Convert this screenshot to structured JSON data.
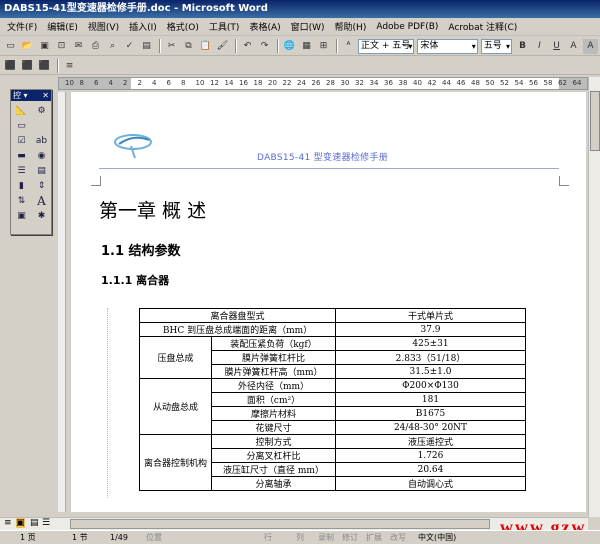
{
  "window": {
    "title": "DABS15-41型变速器检修手册.doc - Microsoft Word"
  },
  "menu": [
    "文件(F)",
    "编辑(E)",
    "视图(V)",
    "插入(I)",
    "格式(O)",
    "工具(T)",
    "表格(A)",
    "窗口(W)",
    "帮助(H)",
    "Adobe PDF(B)",
    "Acrobat 注释(C)"
  ],
  "toolbar": {
    "style_value": "正文 + 五号",
    "font_value": "宋体",
    "size_value": "五号",
    "bold": "B",
    "italic": "I",
    "underline": "U",
    "font_color": "A",
    "char_shading": "A"
  },
  "floatbar": {
    "title": "控"
  },
  "ruler": {
    "labels": [
      "10",
      "8",
      "6",
      "4",
      "2",
      "2",
      "4",
      "6",
      "8",
      "10",
      "12",
      "14",
      "16",
      "18",
      "20",
      "22",
      "24",
      "26",
      "28",
      "30",
      "32",
      "34",
      "36",
      "38",
      "40",
      "42",
      "44",
      "46",
      "48",
      "50",
      "52",
      "54",
      "56",
      "58",
      "62",
      "64"
    ]
  },
  "document": {
    "header": "DABS15-41 型变速器检修手册",
    "heading1": "第一章  概      述",
    "heading2": "1.1    结构参数",
    "heading3": "1.1.1  离合器",
    "table": {
      "rows": [
        {
          "cells": [
            {
              "text": "离合器盘型式",
              "colspan": 2
            },
            {
              "text": "干式单片式"
            }
          ]
        },
        {
          "cells": [
            {
              "text": "BHC 到压盘总成端面的距离（mm）",
              "colspan": 2
            },
            {
              "text": "37.9"
            }
          ]
        },
        {
          "cells": [
            {
              "text": "压盘总成",
              "rowspan": 3
            },
            {
              "text": "装配压紧负荷（kgf）"
            },
            {
              "text": "425±31"
            }
          ]
        },
        {
          "cells": [
            {
              "text": "膜片弹簧杠杆比"
            },
            {
              "text": "2.833（51/18）"
            }
          ]
        },
        {
          "cells": [
            {
              "text": "膜片弹簧杠杆高（mm）"
            },
            {
              "text": "31.5±1.0"
            }
          ]
        },
        {
          "cells": [
            {
              "text": "从动盘总成",
              "rowspan": 4
            },
            {
              "text": "外径内径（mm）"
            },
            {
              "text": "Φ200×Φ130"
            }
          ]
        },
        {
          "cells": [
            {
              "text": "面积（cm²）"
            },
            {
              "text": "181"
            }
          ]
        },
        {
          "cells": [
            {
              "text": "摩擦片材料"
            },
            {
              "text": "B1675"
            }
          ]
        },
        {
          "cells": [
            {
              "text": "花键尺寸"
            },
            {
              "text": "24/48-30°   20NT"
            }
          ]
        },
        {
          "cells": [
            {
              "text": "离合器控制机构",
              "rowspan": 4
            },
            {
              "text": "控制方式"
            },
            {
              "text": "液压遥控式"
            }
          ]
        },
        {
          "cells": [
            {
              "text": "分离叉杠杆比"
            },
            {
              "text": "1.726"
            }
          ]
        },
        {
          "cells": [
            {
              "text": "液压缸尺寸（直径 mm）"
            },
            {
              "text": "20.64"
            }
          ]
        },
        {
          "cells": [
            {
              "text": "分离轴承"
            },
            {
              "text": "自动调心式"
            }
          ]
        }
      ]
    }
  },
  "status": {
    "page": "1 页",
    "section": "1 节",
    "page_of": "1/49",
    "position": "位置",
    "line": "行",
    "column": "列",
    "rec": "录制",
    "trk": "修订",
    "ext": "扩展",
    "ovr": "改写",
    "language": "中文(中国)"
  },
  "watermark": "www.gzw"
}
